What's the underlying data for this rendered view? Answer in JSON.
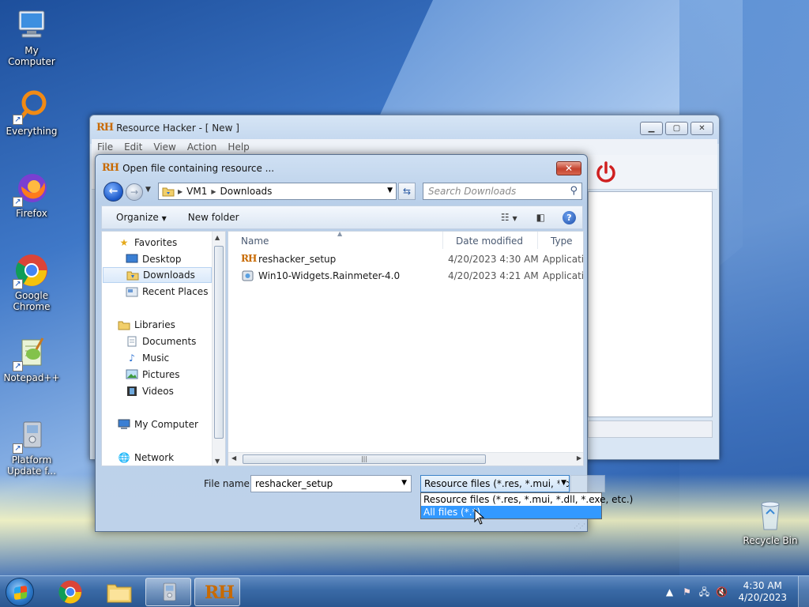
{
  "desktop": {
    "icons": [
      {
        "label": "My Computer"
      },
      {
        "label": "Everything"
      },
      {
        "label": "Firefox"
      },
      {
        "label": "Google Chrome"
      },
      {
        "label": "Notepad++"
      },
      {
        "label": "Platform Update f..."
      },
      {
        "label": "Recycle Bin"
      }
    ]
  },
  "rh_window": {
    "logo": "RH",
    "title": "Resource Hacker - [ New ]",
    "menu": [
      "File",
      "Edit",
      "View",
      "Action",
      "Help"
    ]
  },
  "dialog": {
    "logo": "RH",
    "title": "Open file containing resource ...",
    "close_glyph": "✕",
    "breadcrumb": [
      "VM1",
      "Downloads"
    ],
    "search_placeholder": "Search Downloads",
    "organize_label": "Organize",
    "new_folder_label": "New folder",
    "nav": {
      "favorites_label": "Favorites",
      "favorites": [
        "Desktop",
        "Downloads",
        "Recent Places"
      ],
      "libraries_label": "Libraries",
      "libraries": [
        "Documents",
        "Music",
        "Pictures",
        "Videos"
      ],
      "computer_label": "My Computer",
      "network_label": "Network"
    },
    "columns": {
      "name": "Name",
      "date": "Date modified",
      "type": "Type"
    },
    "files": [
      {
        "name": "reshacker_setup",
        "date": "4/20/2023 4:30 AM",
        "type": "Applicatio"
      },
      {
        "name": "Win10-Widgets.Rainmeter-4.0",
        "date": "4/20/2023 4:21 AM",
        "type": "Applicatio"
      }
    ],
    "file_name_label": "File name:",
    "file_name_value": "reshacker_setup",
    "file_type_selected": "Resource files (*.res, *.mui, *.dll",
    "file_type_options": [
      "Resource files (*.res, *.mui, *.dll, *.exe, etc.)",
      "All files (*.*)"
    ],
    "highlighted_option_index": 1
  },
  "taskbar": {
    "time": "4:30 AM",
    "date": "4/20/2023",
    "items": [
      "chrome",
      "explorer",
      "installer",
      "resource-hacker"
    ],
    "active_item": "resource-hacker"
  },
  "colors": {
    "selection_blue": "#3399ff",
    "close_red": "#c4422e",
    "rh_accent": "#c86a00"
  }
}
